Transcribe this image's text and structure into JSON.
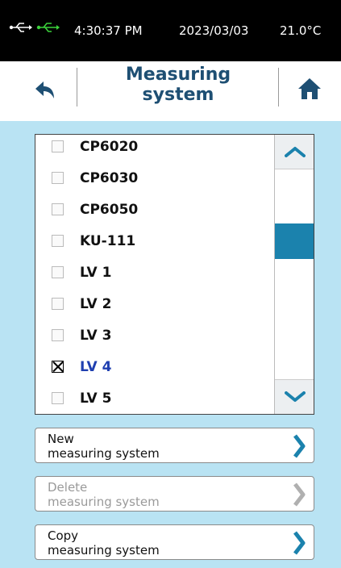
{
  "status_bar": {
    "icons": [
      "usb-icon",
      "usb-connected-icon"
    ],
    "time": "4:30:37 PM",
    "date": "2023/03/03",
    "temperature": "21.0°C"
  },
  "header": {
    "title_line1": "Measuring",
    "title_line2": "system",
    "back_icon": "back-arrow-icon",
    "home_icon": "home-icon"
  },
  "measuring_systems": {
    "items": [
      {
        "label": "CP6020",
        "checked": false
      },
      {
        "label": "CP6030",
        "checked": false
      },
      {
        "label": "CP6050",
        "checked": false
      },
      {
        "label": "KU-111",
        "checked": false
      },
      {
        "label": "LV 1",
        "checked": false
      },
      {
        "label": "LV 2",
        "checked": false
      },
      {
        "label": "LV 3",
        "checked": false
      },
      {
        "label": "LV 4",
        "checked": true
      },
      {
        "label": "LV 5",
        "checked": false
      }
    ],
    "scroll_up_icon": "chevron-up-icon",
    "scroll_down_icon": "chevron-down-icon"
  },
  "actions": {
    "new": {
      "line1": "New",
      "line2": "measuring system",
      "enabled": true
    },
    "delete": {
      "line1": "Delete",
      "line2": "measuring system",
      "enabled": false
    },
    "copy": {
      "line1": "Copy",
      "line2": "measuring system",
      "enabled": true
    }
  },
  "colors": {
    "background": "#b9e3f3",
    "title": "#1e4f73",
    "accent": "#1b82ad",
    "selected_text": "#1f3fb0"
  }
}
